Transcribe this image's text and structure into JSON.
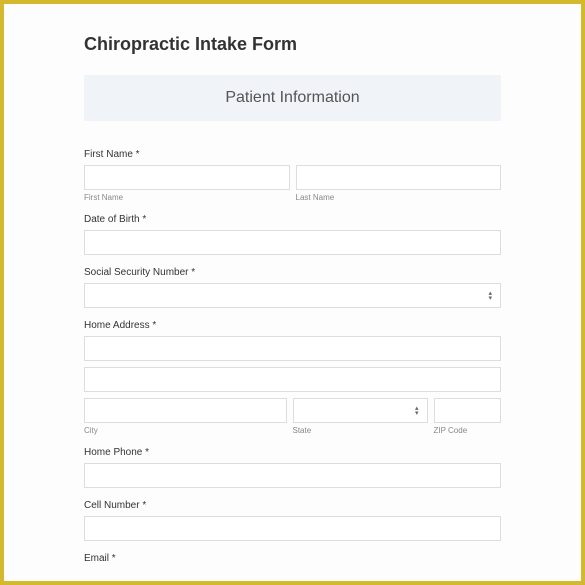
{
  "title": "Chiropractic Intake Form",
  "section": "Patient Information",
  "labels": {
    "first_name": "First Name *",
    "first_name_sub": "First Name",
    "last_name_sub": "Last Name",
    "dob": "Date of Birth *",
    "ssn": "Social Security Number *",
    "home_address": "Home Address *",
    "city_sub": "City",
    "state_sub": "State",
    "zip_sub": "ZIP Code",
    "home_phone": "Home Phone *",
    "cell_number": "Cell Number *",
    "email": "Email *"
  },
  "values": {
    "first_name": "",
    "last_name": "",
    "dob": "",
    "ssn": "",
    "addr1": "",
    "addr2": "",
    "city": "",
    "state": "",
    "zip": "",
    "home_phone": "",
    "cell_number": ""
  }
}
